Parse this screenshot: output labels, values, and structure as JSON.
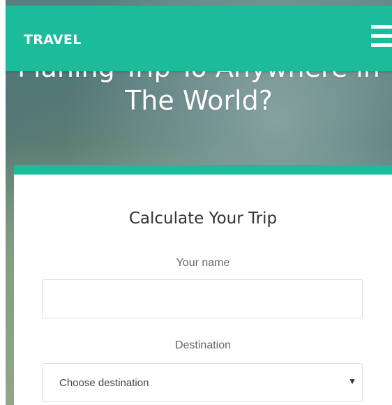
{
  "header": {
    "brand": "TRAVEL",
    "menu_icon": "hamburger-menu-icon",
    "background_color": "#1abc9c"
  },
  "hero": {
    "headline_line1": "Planing Trip To Anywhere in",
    "headline_line2": "The World?"
  },
  "form": {
    "title": "Calculate Your Trip",
    "name_label": "Your name",
    "name_value": "",
    "destination_label": "Destination",
    "destination_selected": "Choose destination",
    "dropdown_icon": "caret-down-icon",
    "accent_color": "#1abc9c"
  }
}
